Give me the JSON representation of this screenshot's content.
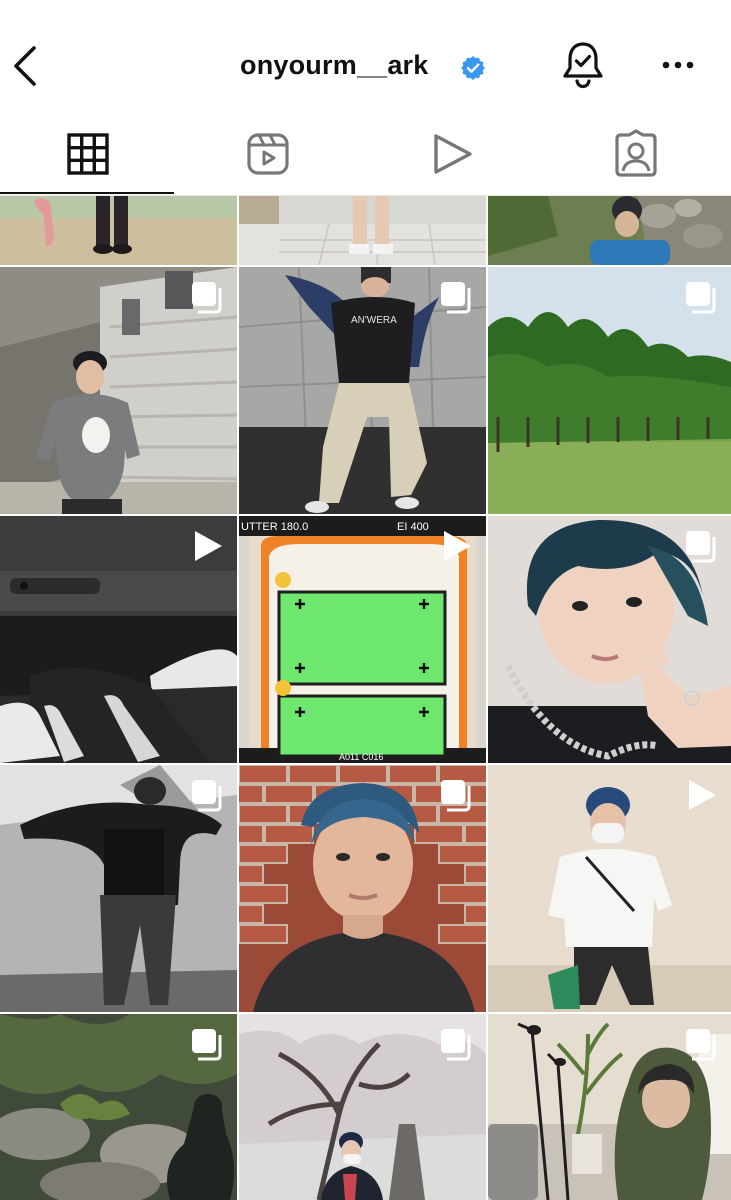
{
  "header": {
    "username": "onyourm__ark",
    "verified": true,
    "back_icon": "chevron-left-icon",
    "bell_icon": "bell-check-icon",
    "more_icon": "more-horizontal-icon"
  },
  "tabs": [
    {
      "name": "grid",
      "icon": "grid-icon",
      "active": true
    },
    {
      "name": "reels",
      "icon": "reels-icon",
      "active": false
    },
    {
      "name": "videos",
      "icon": "play-icon",
      "active": false
    },
    {
      "name": "tagged",
      "icon": "tagged-user-icon",
      "active": false
    }
  ],
  "posts": [
    {
      "id": "p1",
      "badge": "none"
    },
    {
      "id": "p2",
      "badge": "none"
    },
    {
      "id": "p3",
      "badge": "none"
    },
    {
      "id": "p4",
      "badge": "carousel-icon"
    },
    {
      "id": "p5",
      "badge": "carousel-icon"
    },
    {
      "id": "p6",
      "badge": "carousel-icon"
    },
    {
      "id": "p7",
      "badge": "video-icon"
    },
    {
      "id": "p8",
      "badge": "video-icon",
      "overlay_text": {
        "shutter": "UTTER 180.0",
        "ei": "EI 400",
        "bottom": "A011 C016"
      }
    },
    {
      "id": "p9",
      "badge": "carousel-icon"
    },
    {
      "id": "p10",
      "badge": "carousel-icon"
    },
    {
      "id": "p11",
      "badge": "carousel-icon"
    },
    {
      "id": "p12",
      "badge": "video-icon"
    },
    {
      "id": "p13",
      "badge": "carousel-icon"
    },
    {
      "id": "p14",
      "badge": "carousel-icon"
    },
    {
      "id": "p15",
      "badge": "carousel-icon"
    }
  ],
  "colors": {
    "verified_blue": "#3897f0",
    "text": "#111111",
    "icon": "#262626"
  }
}
